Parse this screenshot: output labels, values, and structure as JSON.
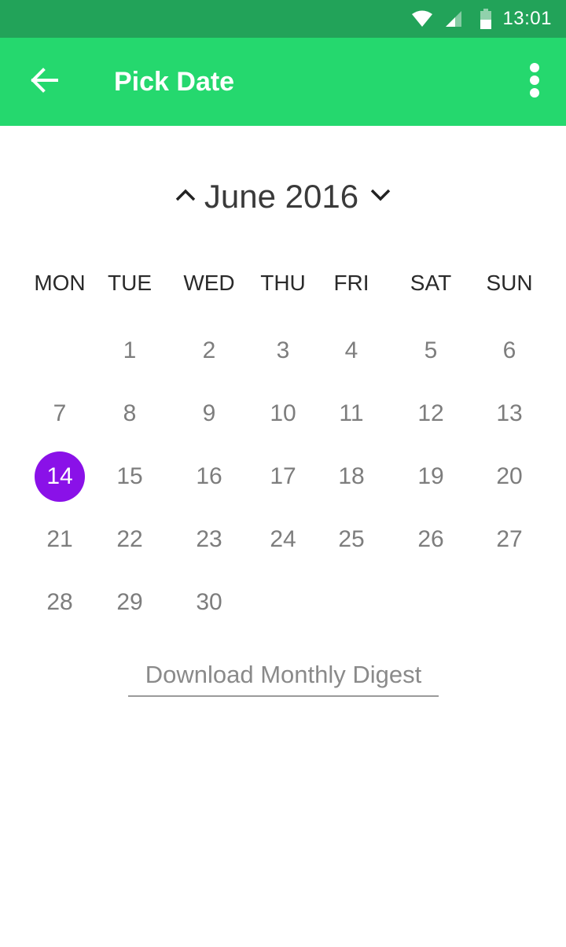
{
  "status_bar": {
    "time": "13:01",
    "icons": [
      "wifi-icon",
      "cellular-signal-icon",
      "battery-icon"
    ]
  },
  "app_bar": {
    "title": "Pick Date",
    "back_icon": "arrow-left-icon",
    "menu_icon": "more-vert-icon"
  },
  "calendar": {
    "month_label": "June 2016",
    "prev_icon": "chevron-up-icon",
    "next_icon": "chevron-down-icon",
    "weekdays": [
      "MON",
      "TUE",
      "WED",
      "THU",
      "FRI",
      "SAT",
      "SUN"
    ],
    "weeks": [
      [
        "",
        "1",
        "2",
        "3",
        "4",
        "5",
        "6"
      ],
      [
        "7",
        "8",
        "9",
        "10",
        "11",
        "12",
        "13"
      ],
      [
        "14",
        "15",
        "16",
        "17",
        "18",
        "19",
        "20"
      ],
      [
        "21",
        "22",
        "23",
        "24",
        "25",
        "26",
        "27"
      ],
      [
        "28",
        "29",
        "30",
        "",
        "",
        "",
        ""
      ]
    ],
    "selected_day": "14"
  },
  "digest_link": "Download Monthly Digest",
  "colors": {
    "status_bar": "#22a359",
    "app_bar": "#25d86e",
    "selected_day": "#8a11e8"
  }
}
